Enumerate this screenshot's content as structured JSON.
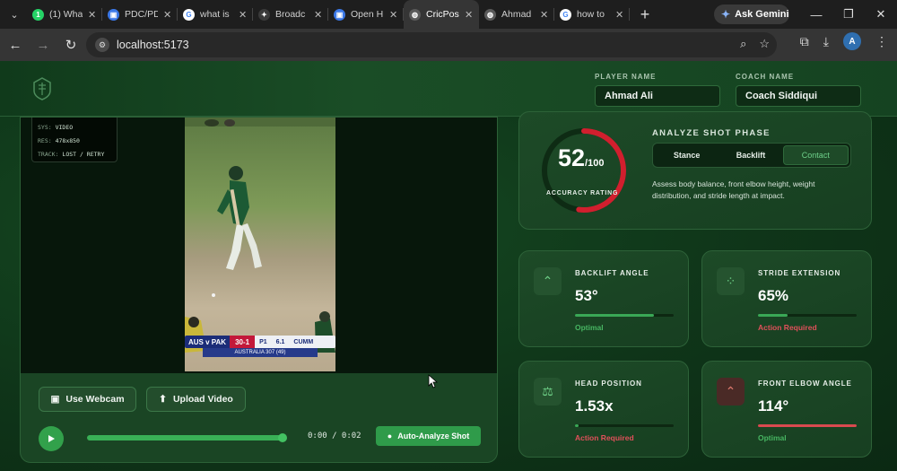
{
  "browser": {
    "tabs": [
      {
        "title": "(1) Wha",
        "fav": "whatsapp",
        "fav_color": "#25d366",
        "fav_glyph": "1"
      },
      {
        "title": "PDC/PD",
        "fav": "classroom",
        "fav_color": "#3b78e7",
        "fav_glyph": "▣"
      },
      {
        "title": "what is",
        "fav": "google",
        "fav_color": "#ffffff",
        "fav_glyph": "G"
      },
      {
        "title": "Broadc",
        "fav": "gemini",
        "fav_color": "#3a3a3a",
        "fav_glyph": "✦"
      },
      {
        "title": "Open H",
        "fav": "classroom",
        "fav_color": "#3b78e7",
        "fav_glyph": "▣"
      },
      {
        "title": "CricPos",
        "fav": "globe",
        "fav_color": "#5a5a5a",
        "fav_glyph": "◍"
      },
      {
        "title": "Ahmad",
        "fav": "globe",
        "fav_color": "#5a5a5a",
        "fav_glyph": "◍"
      },
      {
        "title": "how to",
        "fav": "google",
        "fav_color": "#ffffff",
        "fav_glyph": "G"
      }
    ],
    "active_tab": 5,
    "ask_gemini": "Ask Gemini",
    "url": "localhost:5173",
    "profile_initial": "A"
  },
  "header": {
    "player_label": "PLAYER NAME",
    "player_value": "Ahmad Ali",
    "coach_label": "COACH NAME",
    "coach_value": "Coach Siddiqui"
  },
  "video": {
    "hud": {
      "sys_key": "SYS:",
      "sys_val": "VIDEO",
      "res_key": "RES:",
      "res_val": "478x850",
      "track_key": "TRACK:",
      "track_val": "LOST / RETRY"
    },
    "scoreboard": {
      "teams": "AUS v PAK",
      "runs": "30-1",
      "pp": "P1",
      "over": "6.1",
      "sub": "AUSTRALIA 307 (49)",
      "side": "CUMM"
    },
    "webcam_btn": "Use Webcam",
    "upload_btn": "Upload Video",
    "progress": 1.0,
    "timecode": "0:00 / 0:02",
    "analyze_btn": "Auto-Analyze Shot"
  },
  "accuracy": {
    "value": "52",
    "denominator": "/100",
    "score": 52,
    "label": "ACCURACY RATING",
    "ring_color": "#d11f2e"
  },
  "phase": {
    "title": "ANALYZE SHOT PHASE",
    "options": [
      "Stance",
      "Backlift",
      "Contact"
    ],
    "selected": "Contact",
    "description": "Assess body balance, front elbow height, weight distribution, and stride length at impact."
  },
  "metrics": [
    {
      "title": "BACKLIFT ANGLE",
      "value": "53°",
      "level": 0.8,
      "status": "Optimal",
      "status_color": "#47b562",
      "bar_color": "#3aa856",
      "icon": "chevron-up-icon",
      "icon_bg": "#25532f",
      "icon_color": "#6ecf86"
    },
    {
      "title": "STRIDE EXTENSION",
      "value": "65%",
      "level": 0.3,
      "status": "Action Required",
      "status_color": "#e0505a",
      "bar_color": "#3aa856",
      "icon": "footprints-icon",
      "icon_bg": "#25532f",
      "icon_color": "#6ecf86"
    },
    {
      "title": "HEAD POSITION",
      "value": "1.53x",
      "level": 0.04,
      "status": "Action Required",
      "status_color": "#e0505a",
      "bar_color": "#3aa856",
      "icon": "balance-scale-icon",
      "icon_bg": "#25532f",
      "icon_color": "#6ecf86"
    },
    {
      "title": "FRONT ELBOW ANGLE",
      "value": "114°",
      "level": 1.0,
      "status": "Optimal",
      "status_color": "#47b562",
      "bar_color": "#d94a4f",
      "icon": "chevron-up-icon",
      "icon_bg": "#4a2a26",
      "icon_color": "#e07b6f"
    }
  ]
}
